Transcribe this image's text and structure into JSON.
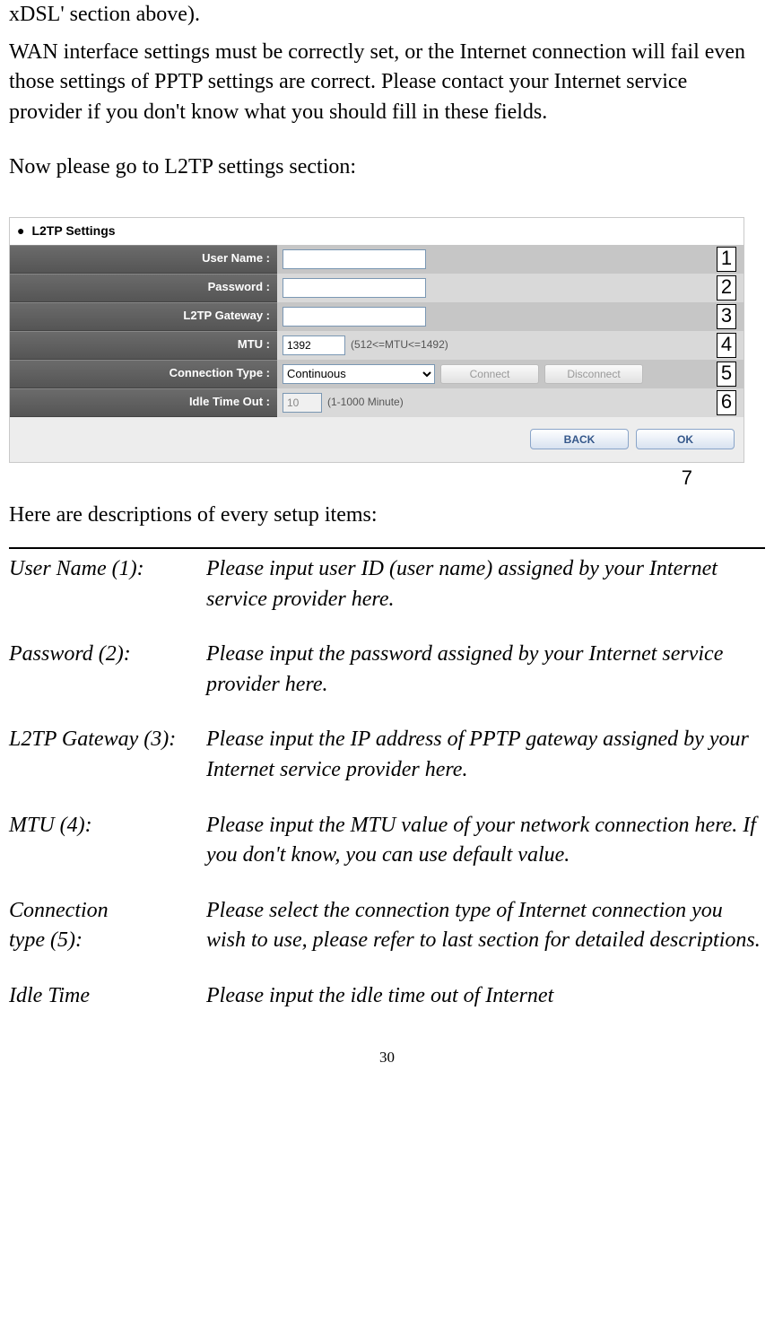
{
  "intro": {
    "line1_fragment": "xDSL' section above).",
    "para1": "WAN interface settings must be correctly set, or the Internet connection will fail even those settings of PPTP settings are correct. Please contact your Internet service provider if you don't know what you should fill in these fields.",
    "para2": "Now please go to L2TP settings section:"
  },
  "panel": {
    "title": "L2TP Settings",
    "rows": {
      "username_label": "User Name :",
      "password_label": "Password :",
      "gateway_label": "L2TP Gateway :",
      "mtu_label": "MTU :",
      "mtu_value": "1392",
      "mtu_hint": "(512<=MTU<=1492)",
      "conn_label": "Connection Type :",
      "conn_value": "Continuous",
      "connect_btn": "Connect",
      "disconnect_btn": "Disconnect",
      "idle_label": "Idle Time Out :",
      "idle_value": "10",
      "idle_hint": "(1-1000 Minute)"
    },
    "footer": {
      "back": "BACK",
      "ok": "OK"
    },
    "callouts": {
      "c1": "1",
      "c2": "2",
      "c3": "3",
      "c4": "4",
      "c5": "5",
      "c6": "6",
      "c7": "7"
    }
  },
  "desc_heading": "Here are descriptions of every setup items:",
  "defs": {
    "user_name_term": "User Name (1):",
    "user_name_desc": "Please input user ID (user name) assigned by your Internet service provider here.",
    "password_term": "Password (2):",
    "password_desc": "Please input the password assigned by your Internet service provider here.",
    "gateway_term": "L2TP Gateway (3):",
    "gateway_desc": "Please input the IP address of PPTP gateway assigned by your Internet service provider here.",
    "mtu_term": "MTU (4):",
    "mtu_desc": "Please input the MTU value of your network connection here. If you don't know, you can use default value.",
    "conn_term_l1": "Connection",
    "conn_term_l2": "type (5):",
    "conn_desc": "Please select the connection type of Internet connection you wish to use, please refer to last section for detailed descriptions.",
    "idle_term_l1": "Idle Time",
    "idle_desc_partial": "Please input the idle time out of Internet"
  },
  "page_number": "30"
}
